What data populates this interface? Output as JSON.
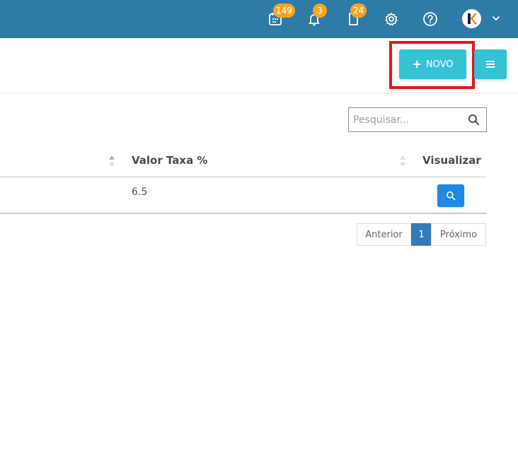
{
  "topbar": {
    "background": "#2e7ba6",
    "badge_color": "#f5a623",
    "icons": [
      {
        "name": "calendar-icon",
        "badge": "149"
      },
      {
        "name": "bell-icon",
        "badge": "3"
      },
      {
        "name": "document-icon",
        "badge": "24"
      },
      {
        "name": "gear-icon"
      },
      {
        "name": "help-icon"
      }
    ],
    "avatar_letter": "K"
  },
  "actions": {
    "novo_label": "NOVO",
    "novo_icon": "plus-icon",
    "menu_icon": "menu-icon",
    "accent": "#35c2d4",
    "highlight": "#e8141c"
  },
  "search": {
    "placeholder": "Pesquisar...",
    "value": ""
  },
  "table": {
    "columns": [
      {
        "label": ""
      },
      {
        "label": "Valor Taxa %"
      },
      {
        "label": "Visualizar"
      }
    ],
    "rows": [
      {
        "valor_taxa": "6.5",
        "view_icon": "search-icon"
      }
    ]
  },
  "pagination": {
    "prev_label": "Anterior",
    "current_page": "1",
    "next_label": "Próximo"
  }
}
